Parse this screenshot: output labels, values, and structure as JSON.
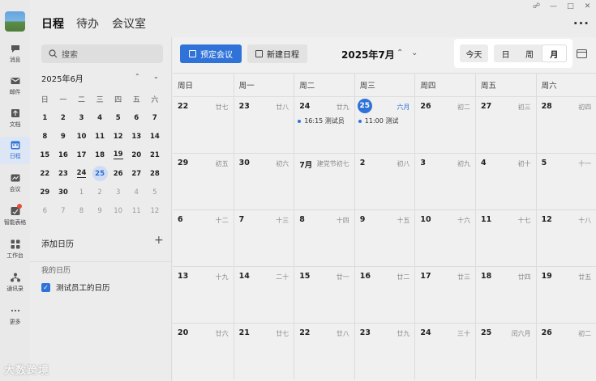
{
  "rail": {
    "items": [
      {
        "label": "消息",
        "icon": "chat-icon"
      },
      {
        "label": "邮件",
        "icon": "mail-icon"
      },
      {
        "label": "文档",
        "icon": "doc-icon"
      },
      {
        "label": "日程",
        "icon": "calendar-icon",
        "active": true
      },
      {
        "label": "会议",
        "icon": "meeting-icon"
      },
      {
        "label": "智能表格",
        "icon": "sheet-icon",
        "badge": true
      },
      {
        "label": "工作台",
        "icon": "workbench-icon"
      },
      {
        "label": "通讯录",
        "icon": "contacts-icon"
      },
      {
        "label": "更多",
        "icon": "more-dots-icon"
      }
    ]
  },
  "topbar": {
    "tabs": [
      "日程",
      "待办",
      "会议室"
    ],
    "more_label": "···"
  },
  "sidebar": {
    "search_placeholder": "搜索",
    "mini_calendar": {
      "title": "2025年6月",
      "weekdays": [
        "日",
        "一",
        "二",
        "三",
        "四",
        "五",
        "六"
      ],
      "rows": [
        [
          "1",
          "2",
          "3",
          "4",
          "5",
          "6",
          "7"
        ],
        [
          "8",
          "9",
          "10",
          "11",
          "12",
          "13",
          "14"
        ],
        [
          "15",
          "16",
          "17",
          "18",
          "19",
          "20",
          "21"
        ],
        [
          "22",
          "23",
          "24",
          "25",
          "26",
          "27",
          "28"
        ],
        [
          "29",
          "30",
          "1",
          "2",
          "3",
          "4",
          "5"
        ],
        [
          "6",
          "7",
          "8",
          "9",
          "10",
          "11",
          "12"
        ]
      ]
    },
    "add_calendar_label": "添加日历",
    "my_calendars_label": "我的日历",
    "calendar_item_label": "测试员工的日历"
  },
  "toolbar": {
    "book_meeting_label": "预定会议",
    "new_event_label": "新建日程",
    "month_title": "2025年7月",
    "today_label": "今天",
    "views": [
      "日",
      "周",
      "月"
    ],
    "active_view": "月"
  },
  "month": {
    "weekday_headers": [
      "周日",
      "周一",
      "周二",
      "周三",
      "周四",
      "周五",
      "周六"
    ],
    "weeks": [
      [
        {
          "d": "22",
          "l": "廿七"
        },
        {
          "d": "23",
          "l": "廿八"
        },
        {
          "d": "24",
          "l": "廿九",
          "ev": "16:15 测试员"
        },
        {
          "d": "25",
          "l": "六月",
          "today": true,
          "ev": "11:00 测试"
        },
        {
          "d": "26",
          "l": "初二"
        },
        {
          "d": "27",
          "l": "初三"
        },
        {
          "d": "28",
          "l": "初四"
        }
      ],
      [
        {
          "d": "29",
          "l": "初五"
        },
        {
          "d": "30",
          "l": "初六"
        },
        {
          "d": "7月",
          "l": "建党节初七"
        },
        {
          "d": "2",
          "l": "初八"
        },
        {
          "d": "3",
          "l": "初九"
        },
        {
          "d": "4",
          "l": "初十"
        },
        {
          "d": "5",
          "l": "十一"
        }
      ],
      [
        {
          "d": "6",
          "l": "十二"
        },
        {
          "d": "7",
          "l": "十三"
        },
        {
          "d": "8",
          "l": "十四"
        },
        {
          "d": "9",
          "l": "十五"
        },
        {
          "d": "10",
          "l": "十六"
        },
        {
          "d": "11",
          "l": "十七"
        },
        {
          "d": "12",
          "l": "十八"
        }
      ],
      [
        {
          "d": "13",
          "l": "十九"
        },
        {
          "d": "14",
          "l": "二十"
        },
        {
          "d": "15",
          "l": "廿一"
        },
        {
          "d": "16",
          "l": "廿二"
        },
        {
          "d": "17",
          "l": "廿三"
        },
        {
          "d": "18",
          "l": "廿四"
        },
        {
          "d": "19",
          "l": "廿五"
        }
      ],
      [
        {
          "d": "20",
          "l": "廿六"
        },
        {
          "d": "21",
          "l": "廿七"
        },
        {
          "d": "22",
          "l": "廿八"
        },
        {
          "d": "23",
          "l": "廿九"
        },
        {
          "d": "24",
          "l": "三十"
        },
        {
          "d": "25",
          "l": "闰六月"
        },
        {
          "d": "26",
          "l": "初二"
        }
      ]
    ]
  },
  "watermark": "大数跨境",
  "colors": {
    "accent": "#2f73d8"
  }
}
